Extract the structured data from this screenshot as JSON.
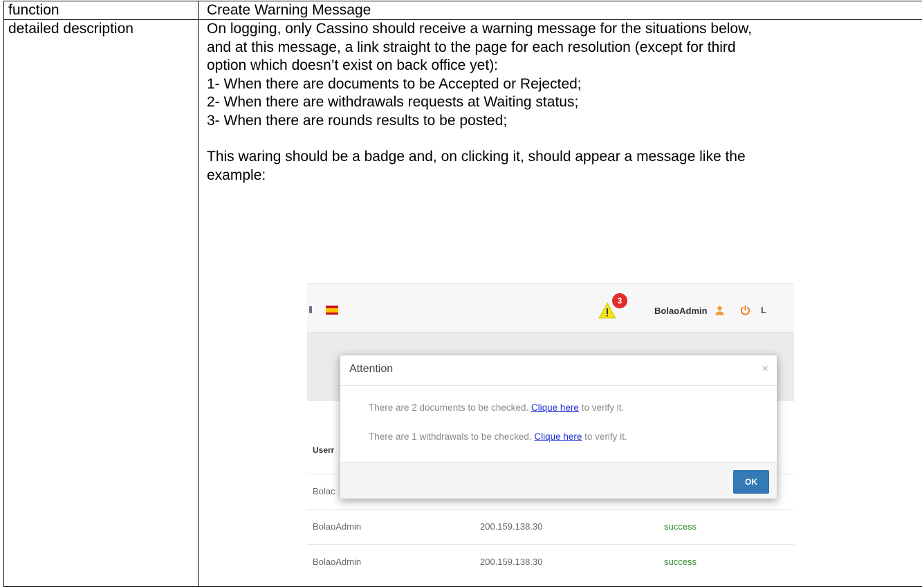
{
  "table": {
    "row1": {
      "label": "function",
      "value": "Create Warning Message"
    },
    "row2": {
      "label": "detailed description",
      "lines": [
        "On logging, only Cassino should receive a warning message for the situations below,",
        "and at this message, a link straight to the page for each resolution (except for third",
        "option which doesn’t exist on back office yet):",
        "1- When there are documents to be Accepted or Rejected;",
        "2- When there are withdrawals requests at Waiting status;",
        "3- When there are rounds results to be posted;"
      ],
      "lines2": [
        "This waring should be a badge and, on clicking it, should appear a message like the",
        "example:"
      ]
    }
  },
  "screenshot": {
    "topbar": {
      "badge_count": "3",
      "username": "BolaoAdmin",
      "logout_partial": "L"
    },
    "modal": {
      "title": "Attention",
      "close": "×",
      "msg1_pre": "There are 2 documents to be checked. ",
      "msg1_link": "Clique here",
      "msg1_post": " to verify it.",
      "msg2_pre": "There are 1 withdrawals to be checked. ",
      "msg2_link": "Clique here",
      "msg2_post": " to verify it.",
      "ok": "OK"
    },
    "grid": {
      "header_partial": "Userr",
      "rows": [
        {
          "user": "Bolac",
          "ip": "",
          "status": ""
        },
        {
          "user": "BolaoAdmin",
          "ip": "200.159.138.30",
          "status": "success"
        },
        {
          "user": "BolaoAdmin",
          "ip": "200.159.138.30",
          "status": "success"
        }
      ]
    },
    "colors": {
      "badge": "#e32c2c",
      "ok_button": "#337ab7",
      "link": "#1f2fd9",
      "success": "#2e8b2e"
    }
  }
}
